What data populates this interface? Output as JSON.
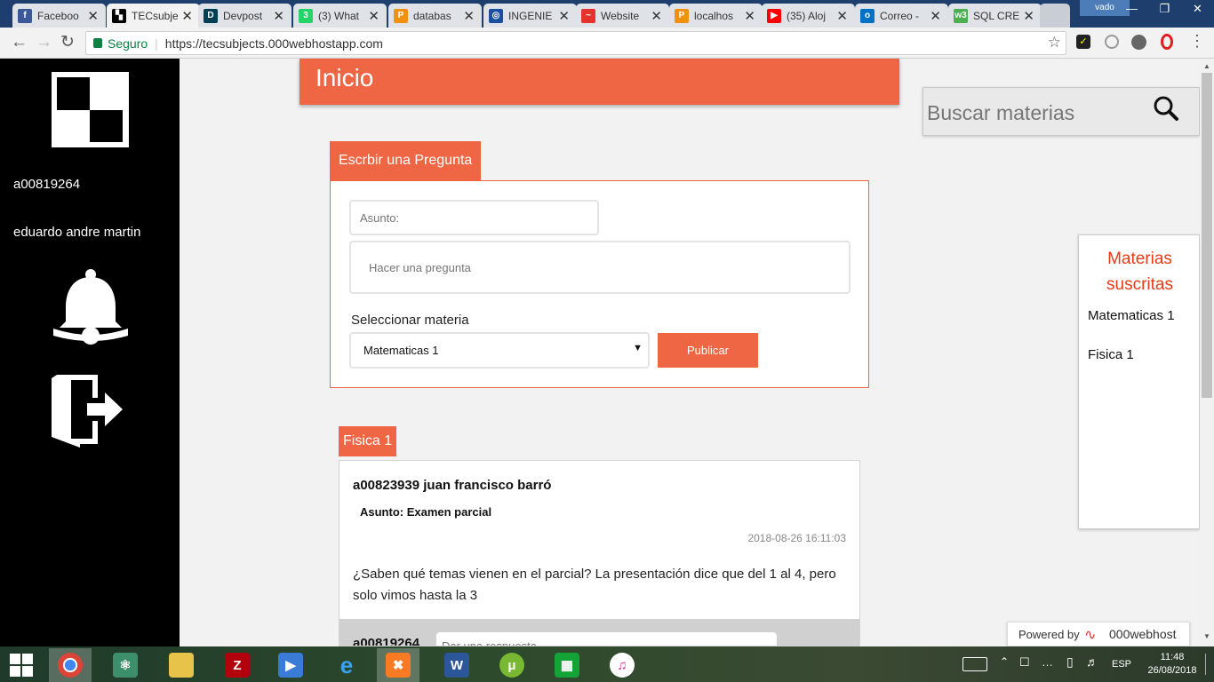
{
  "browser": {
    "tabs": [
      {
        "label": "Faceboo",
        "favicon": "facebook-icon",
        "color": "#3b5998",
        "glyph": "f"
      },
      {
        "label": "TECsubje",
        "favicon": "tecsubjects-icon",
        "color": "#000000",
        "glyph": "▚"
      },
      {
        "label": "Devpost",
        "favicon": "devpost-icon",
        "color": "#003e54",
        "glyph": "D"
      },
      {
        "label": "(3) What",
        "favicon": "whatsapp-icon",
        "color": "#25d366",
        "glyph": "3"
      },
      {
        "label": "databas",
        "favicon": "phpmyadmin-icon",
        "color": "#f29111",
        "glyph": "P"
      },
      {
        "label": "INGENIE",
        "favicon": "globe-icon",
        "color": "#1d4fa0",
        "glyph": "◎"
      },
      {
        "label": "Website",
        "favicon": "000webhost-icon",
        "color": "#e5322d",
        "glyph": "~"
      },
      {
        "label": "localhos",
        "favicon": "phpmyadmin-icon",
        "color": "#f29111",
        "glyph": "P"
      },
      {
        "label": "(35) Aloj",
        "favicon": "youtube-icon",
        "color": "#ff0000",
        "glyph": "▶"
      },
      {
        "label": "Correo -",
        "favicon": "outlook-icon",
        "color": "#0072c6",
        "glyph": "o"
      },
      {
        "label": "SQL CRE",
        "favicon": "w3schools-icon",
        "color": "#4caf50",
        "glyph": "w3"
      }
    ],
    "user_badge": "vado",
    "secure_label": "Seguro",
    "url": "https://tecsubjects.000webhostapp.com"
  },
  "sidebar": {
    "user_id": "a00819264",
    "user_name": "eduardo andre martin"
  },
  "header": {
    "title": "Inicio"
  },
  "search": {
    "placeholder": "Buscar materias"
  },
  "composer": {
    "tab_label": "Escrbir una Pregunta",
    "subject_placeholder": "Asunto:",
    "question_placeholder": "Hacer una pregunta",
    "select_label": "Seleccionar materia",
    "selected_subject": "Matematicas 1",
    "publish_label": "Publicar"
  },
  "post": {
    "subject_tag": "Fisica 1",
    "author": "a00823939 juan francisco barró",
    "subject_line": "Asunto: Examen parcial",
    "timestamp": "2018-08-26 16:11:03",
    "body": "¿Saben qué temas vienen en el parcial? La presentación dice que del 1 al 4, pero solo vimos hasta la 3",
    "reply_user": "a00819264",
    "reply_placeholder": "Dar una respuesta"
  },
  "subscribed": {
    "title": "Materias suscritas",
    "items": [
      "Matematicas 1",
      "Fisica 1"
    ]
  },
  "powered": {
    "prefix": "Powered by",
    "brand": "000webhost"
  },
  "taskbar": {
    "language": "ESP",
    "time": "11:48",
    "date": "26/08/2018"
  },
  "colors": {
    "accent": "#ee6644",
    "subscribed_title": "#e53b17"
  }
}
